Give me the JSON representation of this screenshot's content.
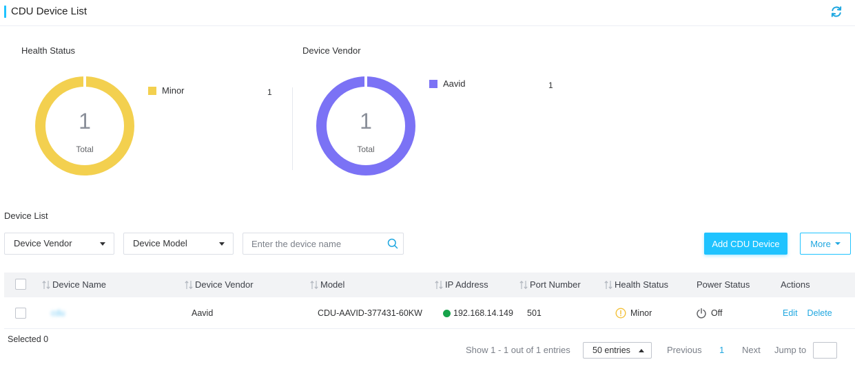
{
  "header": {
    "title": "CDU Device List",
    "refresh_icon": "refresh-icon"
  },
  "health_status": {
    "label": "Health Status",
    "total": "1",
    "total_label": "Total",
    "color": "#f3d04f",
    "legend": [
      {
        "name": "Minor",
        "count": "1",
        "color": "#f3d04f"
      }
    ]
  },
  "device_vendor": {
    "label": "Device Vendor",
    "total": "1",
    "total_label": "Total",
    "color": "#7b72f5",
    "legend": [
      {
        "name": "Aavid",
        "count": "1",
        "color": "#7b72f5"
      }
    ]
  },
  "device_list": {
    "label": "Device List",
    "filters": {
      "vendor": "Device Vendor",
      "model": "Device Model",
      "search_placeholder": "Enter the device name"
    },
    "add_button": "Add CDU Device",
    "more_button": "More",
    "columns": [
      "Device Name",
      "Device Vendor",
      "Model",
      "IP Address",
      "Port Number",
      "Health Status",
      "Power Status",
      "Actions"
    ],
    "rows": [
      {
        "name": "cdu",
        "vendor": "Aavid",
        "model": "CDU-AAVID-377431-60KW",
        "ip": "192.168.14.149",
        "port": "501",
        "health": "Minor",
        "power": "Off",
        "actions": [
          "Edit",
          "Delete"
        ]
      }
    ],
    "colors": {
      "accent": "#1fc3ff",
      "online": "#16a34a",
      "warning": "#f3c13a"
    }
  },
  "footer": {
    "selected": "Selected 0",
    "summary": "Show 1 - 1 out of 1 entries",
    "page_size": "50 entries",
    "previous": "Previous",
    "current_page": "1",
    "next": "Next",
    "jump_to": "Jump to"
  }
}
